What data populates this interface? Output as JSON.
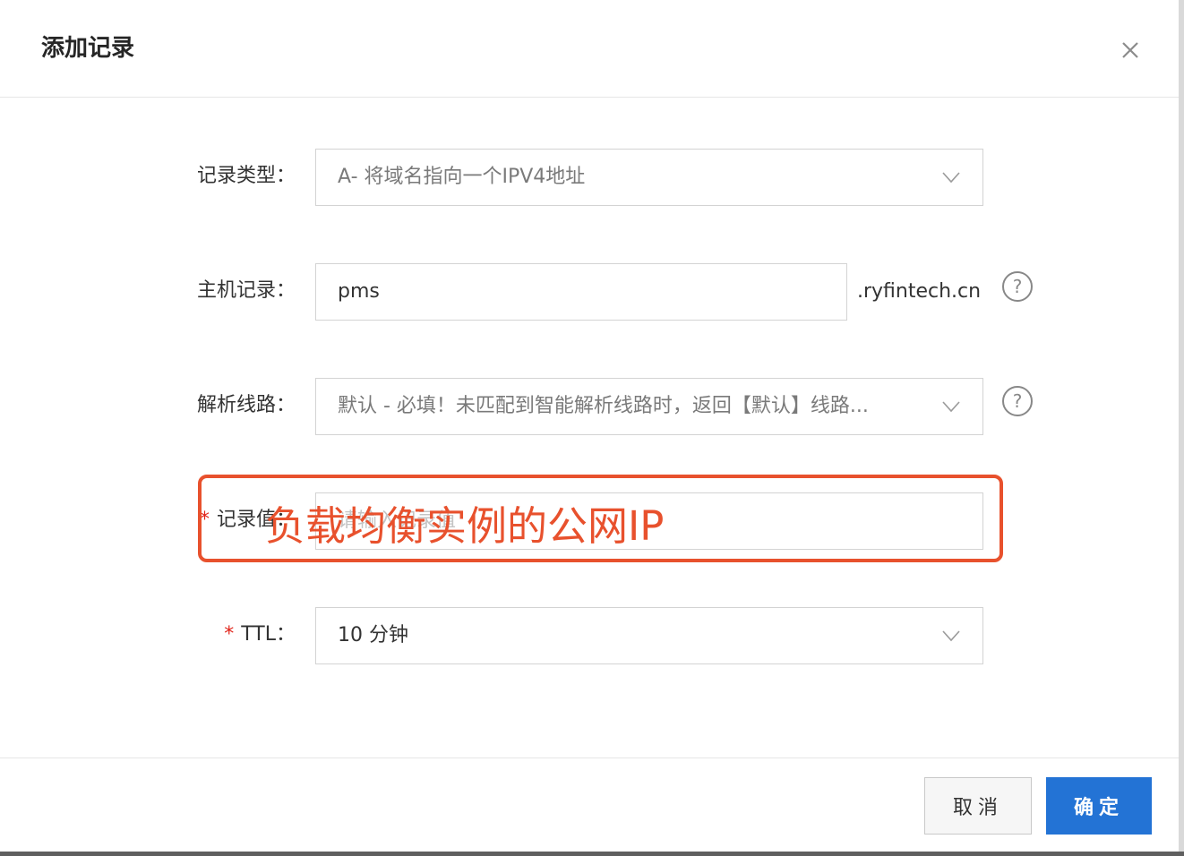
{
  "dialog": {
    "title": "添加记录",
    "close_icon": "close-icon"
  },
  "form": {
    "record_type": {
      "label": "记录类型：",
      "value": "A- 将域名指向一个IPV4地址",
      "icon": "chevron-down-icon"
    },
    "host": {
      "label": "主机记录：",
      "value": "pms",
      "suffix": ".ryfintech.cn",
      "help_icon": "question-circle-icon"
    },
    "line": {
      "label": "解析线路：",
      "value": "默认 - 必填！未匹配到智能解析线路时，返回【默认】线路...",
      "icon": "chevron-down-icon",
      "help_icon": "question-circle-icon"
    },
    "record_value": {
      "required_mark": "*",
      "label": "记录值：",
      "placeholder": "请输入记录值"
    },
    "ttl": {
      "required_mark": "*",
      "label": "TTL：",
      "value": "10 分钟",
      "icon": "chevron-down-icon"
    }
  },
  "annotation": {
    "text": "负载均衡实例的公网IP",
    "color": "#e8512d"
  },
  "footer": {
    "cancel_label": "取消",
    "ok_label": "确定"
  },
  "colors": {
    "primary": "#2373d5",
    "required": "#e1251b"
  }
}
